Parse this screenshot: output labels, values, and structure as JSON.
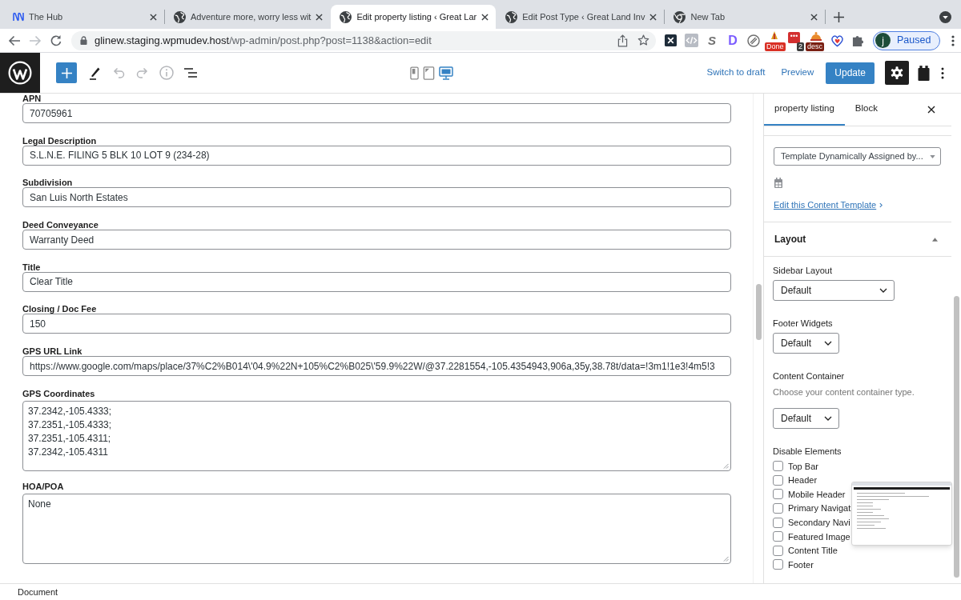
{
  "browser": {
    "tabs": [
      {
        "kind": "hub",
        "title": "The Hub",
        "selected": false
      },
      {
        "kind": "globe",
        "title": "Adventure more, worry less wit",
        "selected": false
      },
      {
        "kind": "globe",
        "title": "Edit property listing ‹ Great Lar",
        "selected": true
      },
      {
        "kind": "globe",
        "title": "Edit Post Type ‹ Great Land Inv",
        "selected": false
      },
      {
        "kind": "chrome",
        "title": "New Tab",
        "selected": false
      }
    ],
    "nav": [
      {
        "kind": "back",
        "disabled": false
      },
      {
        "kind": "forward",
        "disabled": true
      },
      {
        "kind": "reload",
        "disabled": false
      }
    ],
    "address": {
      "host": "glinew.staging.wpmudev.host",
      "path": "/wp-admin/post.php?post=1138&action=edit"
    },
    "extensions": [
      {
        "kind": "x"
      },
      {
        "kind": "code"
      },
      {
        "kind": "script",
        "glyph": "S"
      },
      {
        "kind": "monogram",
        "glyph": "D"
      },
      {
        "kind": "blocked"
      },
      {
        "kind": "cone",
        "badge": "Done",
        "color": "#d93025"
      },
      {
        "kind": "grid",
        "badge": "2",
        "color": "#3c3c3c"
      },
      {
        "kind": "bell",
        "badge": "desc",
        "color": "#7a1f12"
      },
      {
        "kind": "heart"
      },
      {
        "kind": "puzzle"
      }
    ],
    "profile": {
      "initial": "j",
      "status": "Paused"
    }
  },
  "editor": {
    "tools": [
      {
        "kind": "inserter",
        "disabled": false
      },
      {
        "kind": "edit",
        "disabled": false
      },
      {
        "kind": "undo",
        "disabled": true
      },
      {
        "kind": "redo",
        "disabled": true
      },
      {
        "kind": "details",
        "disabled": true
      },
      {
        "kind": "list",
        "disabled": false
      }
    ],
    "devices": [
      {
        "kind": "mobile",
        "selected": false
      },
      {
        "kind": "tablet",
        "selected": false
      },
      {
        "kind": "desktop",
        "selected": true
      }
    ],
    "switch_to_draft": "Switch to draft",
    "preview": "Preview",
    "update": "Update",
    "settings_open": true
  },
  "fields": [
    {
      "kind": "input",
      "label": "APN",
      "value": "70705961"
    },
    {
      "kind": "input",
      "label": "Legal Description",
      "value": "S.L.N.E. FILING 5 BLK 10 LOT 9 (234-28)"
    },
    {
      "kind": "input",
      "label": "Subdivision",
      "value": "San Luis North Estates"
    },
    {
      "kind": "input",
      "label": "Deed Conveyance",
      "value": "Warranty Deed"
    },
    {
      "kind": "input",
      "label": "Title",
      "value": "Clear Title"
    },
    {
      "kind": "input",
      "label": "Closing / Doc Fee",
      "value": "150"
    },
    {
      "kind": "input",
      "label": "GPS URL Link",
      "value": "https://www.google.com/maps/place/37%C2%B014\\'04.9%22N+105%C2%B025\\'59.9%22W/@37.2281554,-105.4354943,906a,35y,38.78t/data=!3m1!1e3!4m5!3"
    },
    {
      "kind": "textarea",
      "label": "GPS Coordinates",
      "value": "37.2342,-105.4333;\n37.2351,-105.4333;\n37.2351,-105.4311;\n37.2342,-105.4311"
    },
    {
      "kind": "textarea",
      "label": "HOA/POA",
      "value": "None"
    }
  ],
  "sidebar": {
    "tabs": [
      {
        "label": "property listing",
        "selected": true
      },
      {
        "label": "Block",
        "selected": false
      }
    ],
    "template": {
      "value": "Template Dynamically Assigned by...",
      "link": "Edit this Content Template"
    },
    "panels": [
      {
        "title": "Layout",
        "expanded": true,
        "settings": [
          {
            "kind": "select",
            "label": "Sidebar Layout",
            "value": "Default"
          },
          {
            "kind": "select",
            "label": "Footer Widgets",
            "value": "Default"
          },
          {
            "kind": "select",
            "label": "Content Container",
            "help": "Choose your content container type.",
            "value": "Default"
          },
          {
            "kind": "checklist",
            "label": "Disable Elements",
            "options": [
              {
                "label": "Top Bar",
                "checked": false
              },
              {
                "label": "Header",
                "checked": false
              },
              {
                "label": "Mobile Header",
                "checked": false
              },
              {
                "label": "Primary Navigat",
                "checked": false
              },
              {
                "label": "Secondary Navi",
                "checked": false
              },
              {
                "label": "Featured Image",
                "checked": false
              },
              {
                "label": "Content Title",
                "checked": false
              },
              {
                "label": "Footer",
                "checked": false
              }
            ]
          }
        ]
      }
    ]
  },
  "status_bar": {
    "breadcrumb": "Document"
  }
}
